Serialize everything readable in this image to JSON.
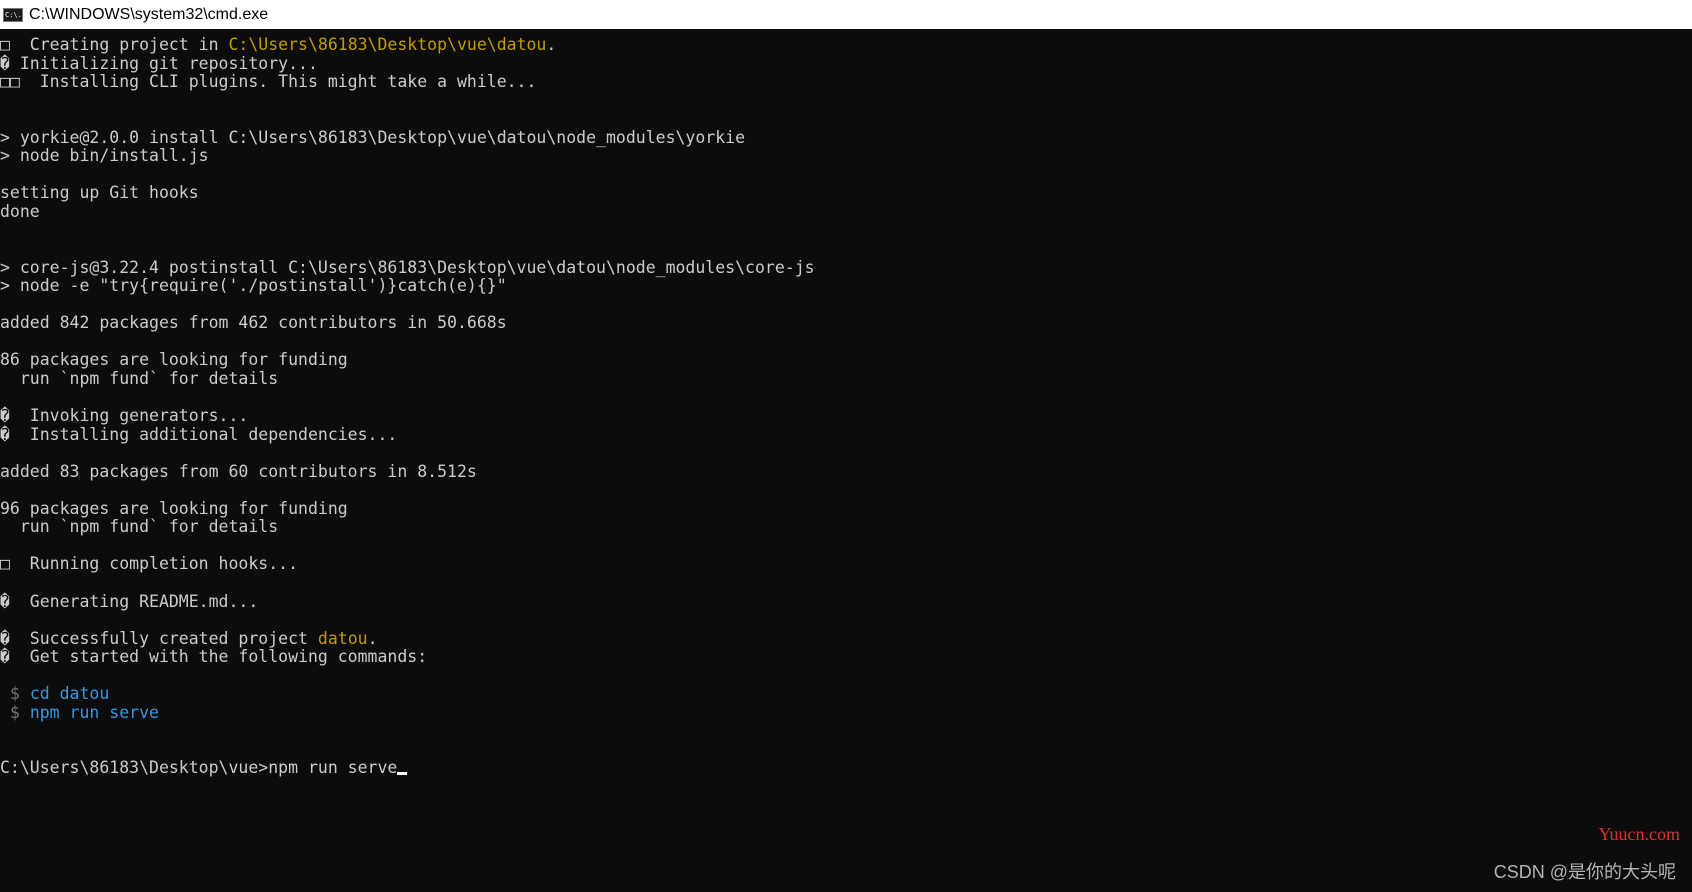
{
  "window": {
    "title": "C:\\WINDOWS\\system32\\cmd.exe",
    "icon": "cmd-icon",
    "icon_text": "C:\\."
  },
  "colors": {
    "background": "#0c0c0c",
    "text": "#cccccc",
    "yellow": "#c19c00",
    "cyan": "#3a96dd",
    "gray": "#767676",
    "watermark_red": "#e0302b"
  },
  "terminal": {
    "lines": [
      {
        "segs": [
          {
            "t": "□  Creating project in ",
            "c": "text"
          },
          {
            "t": "C:\\Users\\86183\\Desktop\\vue\\datou",
            "c": "yellow"
          },
          {
            "t": ".",
            "c": "text"
          }
        ]
      },
      {
        "segs": [
          {
            "t": "� Initializing git repository...",
            "c": "text"
          }
        ]
      },
      {
        "segs": [
          {
            "t": "□□  Installing CLI plugins. This might take a while...",
            "c": "text"
          }
        ]
      },
      {
        "segs": []
      },
      {
        "segs": []
      },
      {
        "segs": [
          {
            "t": "> yorkie@2.0.0 install C:\\Users\\86183\\Desktop\\vue\\datou\\node_modules\\yorkie",
            "c": "text"
          }
        ]
      },
      {
        "segs": [
          {
            "t": "> node bin/install.js",
            "c": "text"
          }
        ]
      },
      {
        "segs": []
      },
      {
        "segs": [
          {
            "t": "setting up Git hooks",
            "c": "text"
          }
        ]
      },
      {
        "segs": [
          {
            "t": "done",
            "c": "text"
          }
        ]
      },
      {
        "segs": []
      },
      {
        "segs": []
      },
      {
        "segs": [
          {
            "t": "> core-js@3.22.4 postinstall C:\\Users\\86183\\Desktop\\vue\\datou\\node_modules\\core-js",
            "c": "text"
          }
        ]
      },
      {
        "segs": [
          {
            "t": "> node -e \"try{require('./postinstall')}catch(e){}\"",
            "c": "text"
          }
        ]
      },
      {
        "segs": []
      },
      {
        "segs": [
          {
            "t": "added 842 packages from 462 contributors in 50.668s",
            "c": "text"
          }
        ]
      },
      {
        "segs": []
      },
      {
        "segs": [
          {
            "t": "86 packages are looking for funding",
            "c": "text"
          }
        ]
      },
      {
        "segs": [
          {
            "t": "  run `npm fund` for details",
            "c": "text"
          }
        ]
      },
      {
        "segs": []
      },
      {
        "segs": [
          {
            "t": "�  Invoking generators...",
            "c": "text"
          }
        ]
      },
      {
        "segs": [
          {
            "t": "�  Installing additional dependencies...",
            "c": "text"
          }
        ]
      },
      {
        "segs": []
      },
      {
        "segs": [
          {
            "t": "added 83 packages from 60 contributors in 8.512s",
            "c": "text"
          }
        ]
      },
      {
        "segs": []
      },
      {
        "segs": [
          {
            "t": "96 packages are looking for funding",
            "c": "text"
          }
        ]
      },
      {
        "segs": [
          {
            "t": "  run `npm fund` for details",
            "c": "text"
          }
        ]
      },
      {
        "segs": []
      },
      {
        "segs": [
          {
            "t": "□  Running completion hooks...",
            "c": "text"
          }
        ]
      },
      {
        "segs": []
      },
      {
        "segs": [
          {
            "t": "�  Generating README.md...",
            "c": "text"
          }
        ]
      },
      {
        "segs": []
      },
      {
        "segs": [
          {
            "t": "�  Successfully created project ",
            "c": "text"
          },
          {
            "t": "datou",
            "c": "yellow"
          },
          {
            "t": ".",
            "c": "text"
          }
        ]
      },
      {
        "segs": [
          {
            "t": "�  Get started with the following commands:",
            "c": "text"
          }
        ]
      },
      {
        "segs": []
      },
      {
        "segs": [
          {
            "t": " $ ",
            "c": "gray"
          },
          {
            "t": "cd datou",
            "c": "cyan"
          }
        ]
      },
      {
        "segs": [
          {
            "t": " $ ",
            "c": "gray"
          },
          {
            "t": "npm run serve",
            "c": "cyan"
          }
        ]
      },
      {
        "segs": []
      },
      {
        "segs": []
      },
      {
        "segs": [
          {
            "t": "C:\\Users\\86183\\Desktop\\vue>npm run serve",
            "c": "text"
          }
        ],
        "cursor": true
      }
    ]
  },
  "watermarks": {
    "site": "Yuucn.com",
    "author": "CSDN @是你的大头呢"
  }
}
